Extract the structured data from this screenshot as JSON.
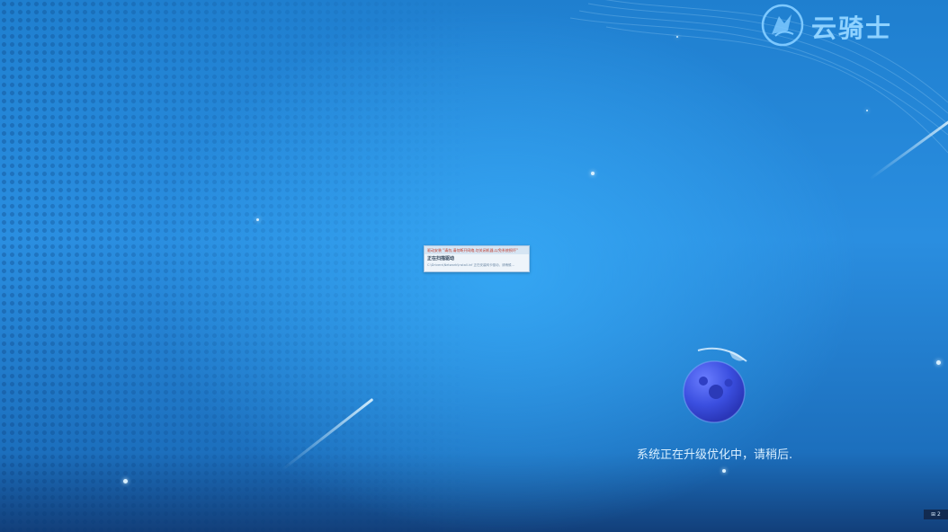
{
  "brand": {
    "logo_text": "云骑士",
    "emblem_icon": "knight-emblem-icon",
    "accent_color": "#8fd2ff"
  },
  "dialog": {
    "header_text": "驱动安装 \"请勿,请勿断开网络,勿关闭机器,以免系统损坏\"",
    "title": "正在扫描驱动",
    "detail_line": "C:\\Drivers\\Network\\install.inf 正在安装网卡驱动，请稍候..."
  },
  "status": {
    "message": "系统正在升级优化中，请稍后.",
    "planet_icon": "planet-icon"
  },
  "taskbar": {
    "corner_label": "⊞ 2"
  },
  "colors": {
    "background_top": "#1f7fcf",
    "background_center": "#35a6f3",
    "background_bottom": "#123f7a"
  }
}
